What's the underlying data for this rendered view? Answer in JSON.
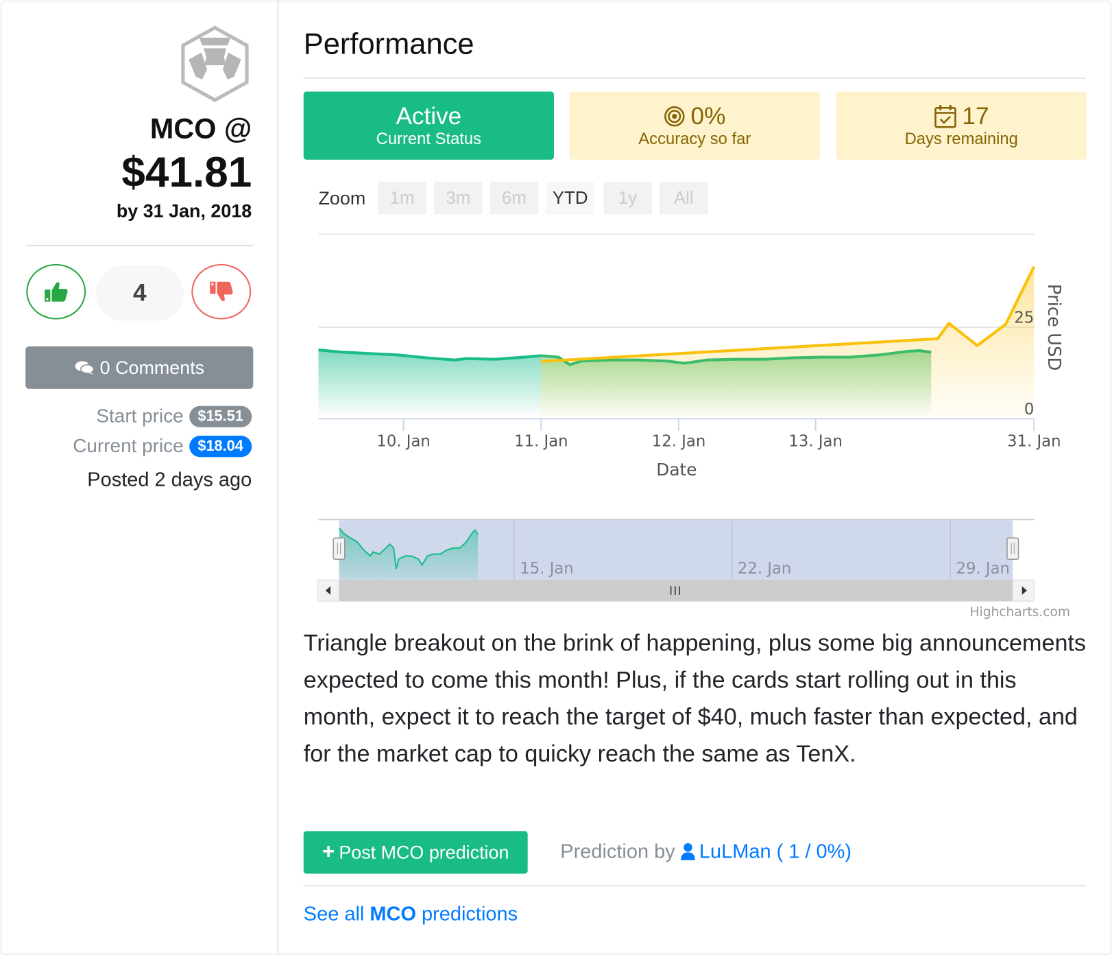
{
  "sidebar": {
    "coin_logo": "crypto-com-hexagon-logo",
    "symbol_line": "MCO @",
    "target_price": "$41.81",
    "by_date": "by 31 Jan, 2018",
    "vote_count": "4",
    "comments_label": "0 Comments",
    "start_price_label": "Start price",
    "start_price": "$15.51",
    "current_price_label": "Current price",
    "current_price": "$18.04",
    "posted": "Posted 2 days ago"
  },
  "main": {
    "title": "Performance",
    "cards": [
      {
        "value": "Active",
        "label": "Current Status",
        "color": "#18bc84"
      },
      {
        "icon": "target-icon",
        "value": "0%",
        "label": "Accuracy so far",
        "color": "#fff3cd"
      },
      {
        "icon": "calendar-check-icon",
        "value": "17",
        "label": "Days remaining",
        "color": "#fff3cd"
      }
    ],
    "zoom_label": "Zoom",
    "zoom_buttons": [
      "1m",
      "3m",
      "6m",
      "YTD",
      "1y",
      "All"
    ],
    "zoom_selected": "YTD",
    "description": "Triangle breakout on the brink of happening, plus some big announcements expected to come this month! Plus, if the cards start rolling out in this month, expect it to reach the target of $40, much faster than expected, and for the market cap to quicky reach the same as TenX.",
    "post_button": "Post MCO prediction",
    "prediction_by_label": "Prediction by",
    "author": "LuLMan ( 1 / 0%)",
    "see_all_prefix": "See all",
    "see_all_symbol": "MCO",
    "see_all_suffix": "predictions"
  },
  "chart_data": {
    "type": "area",
    "xlabel": "Date",
    "ylabel": "Price USD",
    "ylim": [
      0,
      50
    ],
    "yticks": [
      "0",
      "25"
    ],
    "xticks": [
      "10. Jan",
      "11. Jan",
      "12. Jan",
      "13. Jan",
      "31. Jan"
    ],
    "navigator_ticks": [
      "15. Jan",
      "22. Jan",
      "29. Jan"
    ],
    "credits": "Highcharts.com",
    "grid": true,
    "series": [
      {
        "colors": {
          "before_prediction": "#1abc8c",
          "after_prediction": "#3dbb6a"
        },
        "points": [
          [
            "2018-01-09T09:00",
            18.7
          ],
          [
            "2018-01-09T13:00",
            18.1
          ],
          [
            "2018-01-09T18:00",
            17.7
          ],
          [
            "2018-01-09T23:00",
            17.3
          ],
          [
            "2018-01-10T04:00",
            16.5
          ],
          [
            "2018-01-10T09:00",
            15.9
          ],
          [
            "2018-01-10T11:00",
            16.3
          ],
          [
            "2018-01-10T16:00",
            16.1
          ],
          [
            "2018-01-10T21:00",
            16.7
          ],
          [
            "2018-01-11T00:00",
            17.1
          ],
          [
            "2018-01-11T03:00",
            16.7
          ],
          [
            "2018-01-11T05:00",
            14.6
          ],
          [
            "2018-01-11T07:00",
            15.6
          ],
          [
            "2018-01-11T12:00",
            15.9
          ],
          [
            "2018-01-11T17:00",
            15.9
          ],
          [
            "2018-01-11T22:00",
            15.6
          ],
          [
            "2018-01-12T01:00",
            15.0
          ],
          [
            "2018-01-12T05:00",
            15.9
          ],
          [
            "2018-01-12T10:00",
            16.1
          ],
          [
            "2018-01-12T15:00",
            16.1
          ],
          [
            "2018-01-12T20:00",
            16.5
          ],
          [
            "2018-01-13T01:00",
            16.7
          ],
          [
            "2018-01-13T06:00",
            16.7
          ],
          [
            "2018-01-13T11:00",
            17.3
          ],
          [
            "2018-01-13T16:00",
            18.3
          ],
          [
            "2018-01-13T18:00",
            18.5
          ],
          [
            "2018-01-13T20:00",
            18.04
          ]
        ]
      },
      {
        "color": "#f9c10c",
        "points": [
          [
            "2018-01-11T00:00",
            15.51
          ],
          [
            "2018-01-14T00:00",
            21.8
          ],
          [
            "2018-01-17T00:00",
            26.1
          ],
          [
            "2018-01-21T00:00",
            19.9
          ],
          [
            "2018-01-25T00:00",
            25.8
          ],
          [
            "2018-01-31T00:00",
            41.81
          ]
        ]
      }
    ]
  }
}
